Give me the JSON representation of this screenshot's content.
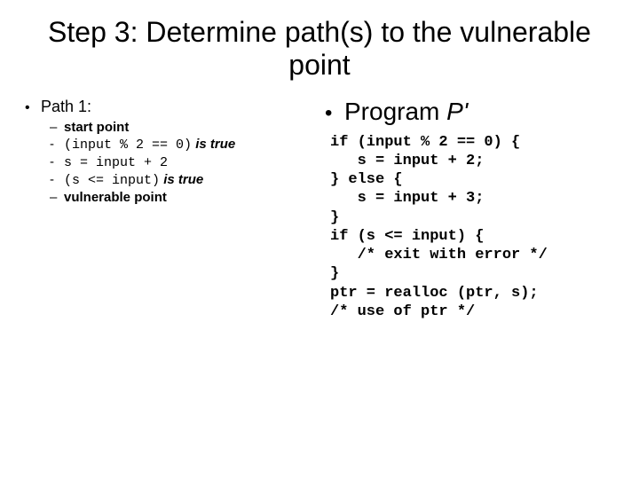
{
  "title": "Step 3: Determine path(s) to the vulnerable point",
  "left": {
    "header": "Path 1:",
    "items": [
      {
        "dash": "–",
        "bold": "start point"
      },
      {
        "dash": "-",
        "mono": "(input % 2 == 0)",
        "ital": " is true"
      },
      {
        "dash": "-",
        "mono": "s = input + 2"
      },
      {
        "dash": "-",
        "mono": "(s <= input)",
        "ital": " is true"
      },
      {
        "dash": "–",
        "bold": "vulnerable point"
      }
    ]
  },
  "right": {
    "header_pre": "Program ",
    "header_prime": "P'",
    "code": "if (input % 2 == 0) {\n   s = input + 2;\n} else {\n   s = input + 3;\n}\nif (s <= input) {\n   /* exit with error */\n}\nptr = realloc (ptr, s);\n/* use of ptr */"
  }
}
